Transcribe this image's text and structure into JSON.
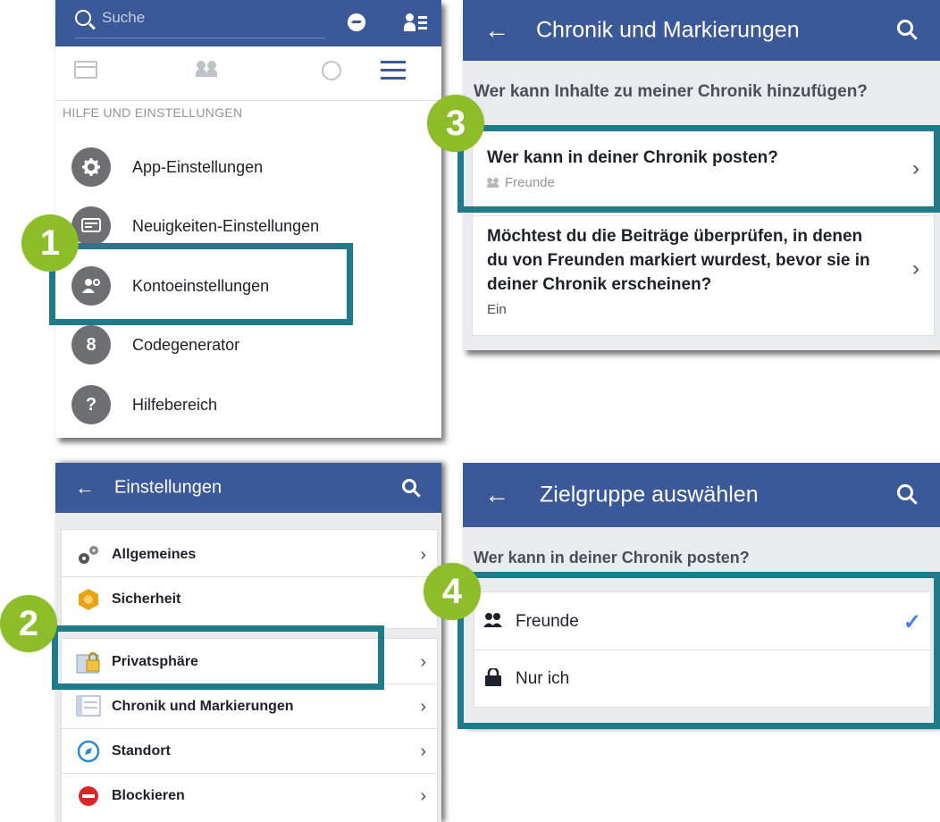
{
  "panel1": {
    "search_placeholder": "Suche",
    "section_title": "HILFE UND EINSTELLUNGEN",
    "items": [
      {
        "label": "App-Einstellungen"
      },
      {
        "label": "Neuigkeiten-Einstellungen"
      },
      {
        "label": "Kontoeinstellungen"
      },
      {
        "label": "Codegenerator"
      },
      {
        "label": "Hilfebereich"
      }
    ],
    "code_icon_glyph": "8",
    "help_icon_glyph": "?"
  },
  "panel2": {
    "title": "Chronik und Markierungen",
    "question": "Wer kann Inhalte zu meiner Chronik hinzufügen?",
    "row1_title": "Wer kann in deiner Chronik posten?",
    "row1_sub": "Freunde",
    "row2_title": "Möchtest du die Beiträge überprüfen, in denen du von Freunden markiert wurdest, bevor sie in deiner Chronik erscheinen?",
    "row2_sub": "Ein"
  },
  "panel3": {
    "title": "Einstellungen",
    "rows": [
      {
        "label": "Allgemeines",
        "icon": "gears-icon"
      },
      {
        "label": "Sicherheit",
        "icon": "shield-badge-icon"
      },
      {
        "label": "Privatsphäre",
        "icon": "lock-folder-icon"
      },
      {
        "label": "Chronik und Markierungen",
        "icon": "timeline-icon"
      },
      {
        "label": "Standort",
        "icon": "compass-icon"
      },
      {
        "label": "Blockieren",
        "icon": "block-icon"
      }
    ]
  },
  "panel4": {
    "title": "Zielgruppe auswählen",
    "question": "Wer kann in deiner Chronik posten?",
    "options": [
      {
        "label": "Freunde",
        "selected": true
      },
      {
        "label": "Nur ich",
        "selected": false
      }
    ]
  },
  "badges": {
    "b1": "1",
    "b2": "2",
    "b3": "3",
    "b4": "4"
  },
  "glyphs": {
    "back_arrow": "←",
    "chevron": "›",
    "check": "✓"
  },
  "colors": {
    "fb_blue": "#3b5998",
    "highlight": "#1f7b8a",
    "badge_green": "#8dbe2a",
    "check_blue": "#4080ff"
  }
}
